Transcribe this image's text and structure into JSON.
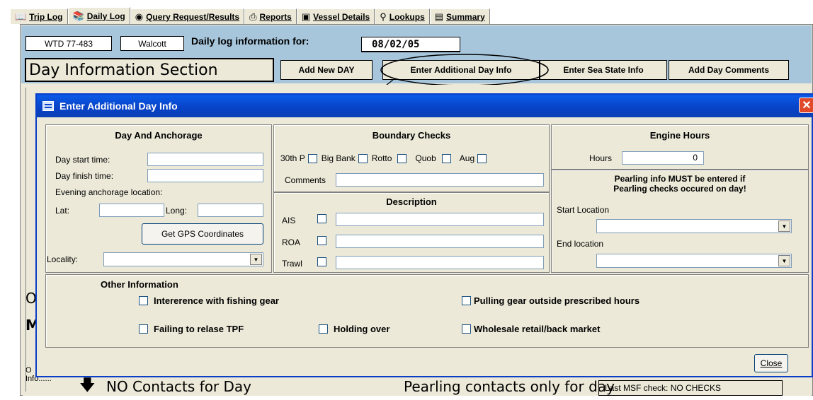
{
  "tabs": [
    {
      "label": "Trip Log",
      "icon": "book-icon"
    },
    {
      "label": "Daily Log",
      "icon": "open-book-icon",
      "active": true
    },
    {
      "label": "Query Request/Results",
      "icon": "binoculars-icon"
    },
    {
      "label": "Reports",
      "icon": "printer-icon"
    },
    {
      "label": "Vessel Details",
      "icon": "camera-icon"
    },
    {
      "label": "Lookups",
      "icon": "magnifier-icon"
    },
    {
      "label": "Summary",
      "icon": "zoom-document-icon"
    }
  ],
  "header": {
    "vessel_id": "WTD 77-483",
    "name": "Walcott",
    "daily_log_label": "Daily log information for:",
    "date": "08/02/05",
    "section_title": "Day Information Section",
    "buttons": {
      "add_new_day": "Add New DAY",
      "enter_additional_day_info": "Enter Additional Day Info",
      "enter_sea_state_info": "Enter Sea State Info",
      "add_day_comments": "Add Day Comments"
    }
  },
  "background": {
    "letter_o": "O",
    "letter_m": "M",
    "info_label_1": "O",
    "info_label_2": "Info......",
    "contacts_text": "NO Contacts for Day",
    "pearling_text": "Pearling contacts only for day",
    "last_msf_check": "Last MSF check: NO CHECKS"
  },
  "dialog": {
    "title": "Enter Additional Day Info",
    "day_anchorage": {
      "title": "Day And Anchorage",
      "start_time_label": "Day start time:",
      "finish_time_label": "Day finish time:",
      "anchorage_label": "Evening anchorage location:",
      "lat_label": "Lat:",
      "long_label": "Long:",
      "gps_button": "Get GPS Coordinates",
      "locality_label": "Locality:"
    },
    "boundary_checks": {
      "title": "Boundary Checks",
      "items": [
        "30th P",
        "Big Bank",
        "Rotto",
        "Quob",
        "Aug"
      ],
      "comments_label": "Comments"
    },
    "description": {
      "title": "Description",
      "rows": [
        "AIS",
        "ROA",
        "Trawl"
      ]
    },
    "engine_hours": {
      "title": "Engine Hours",
      "hours_label": "Hours",
      "hours_value": "0"
    },
    "pearling": {
      "notice_line1": "Pearling info MUST be entered if",
      "notice_line2": "Pearling checks occured on day!",
      "start_location_label": "Start Location",
      "end_location_label": "End location"
    },
    "other_information": {
      "title": "Other Information",
      "interference": "Intererence with fishing gear",
      "pulling_gear": "Pulling gear outside prescribed hours",
      "failing_tpf": "Failing to relase TPF",
      "holding_over": "Holding over",
      "wholesale": "Wholesale retail/back market"
    },
    "close_button": "Close"
  }
}
